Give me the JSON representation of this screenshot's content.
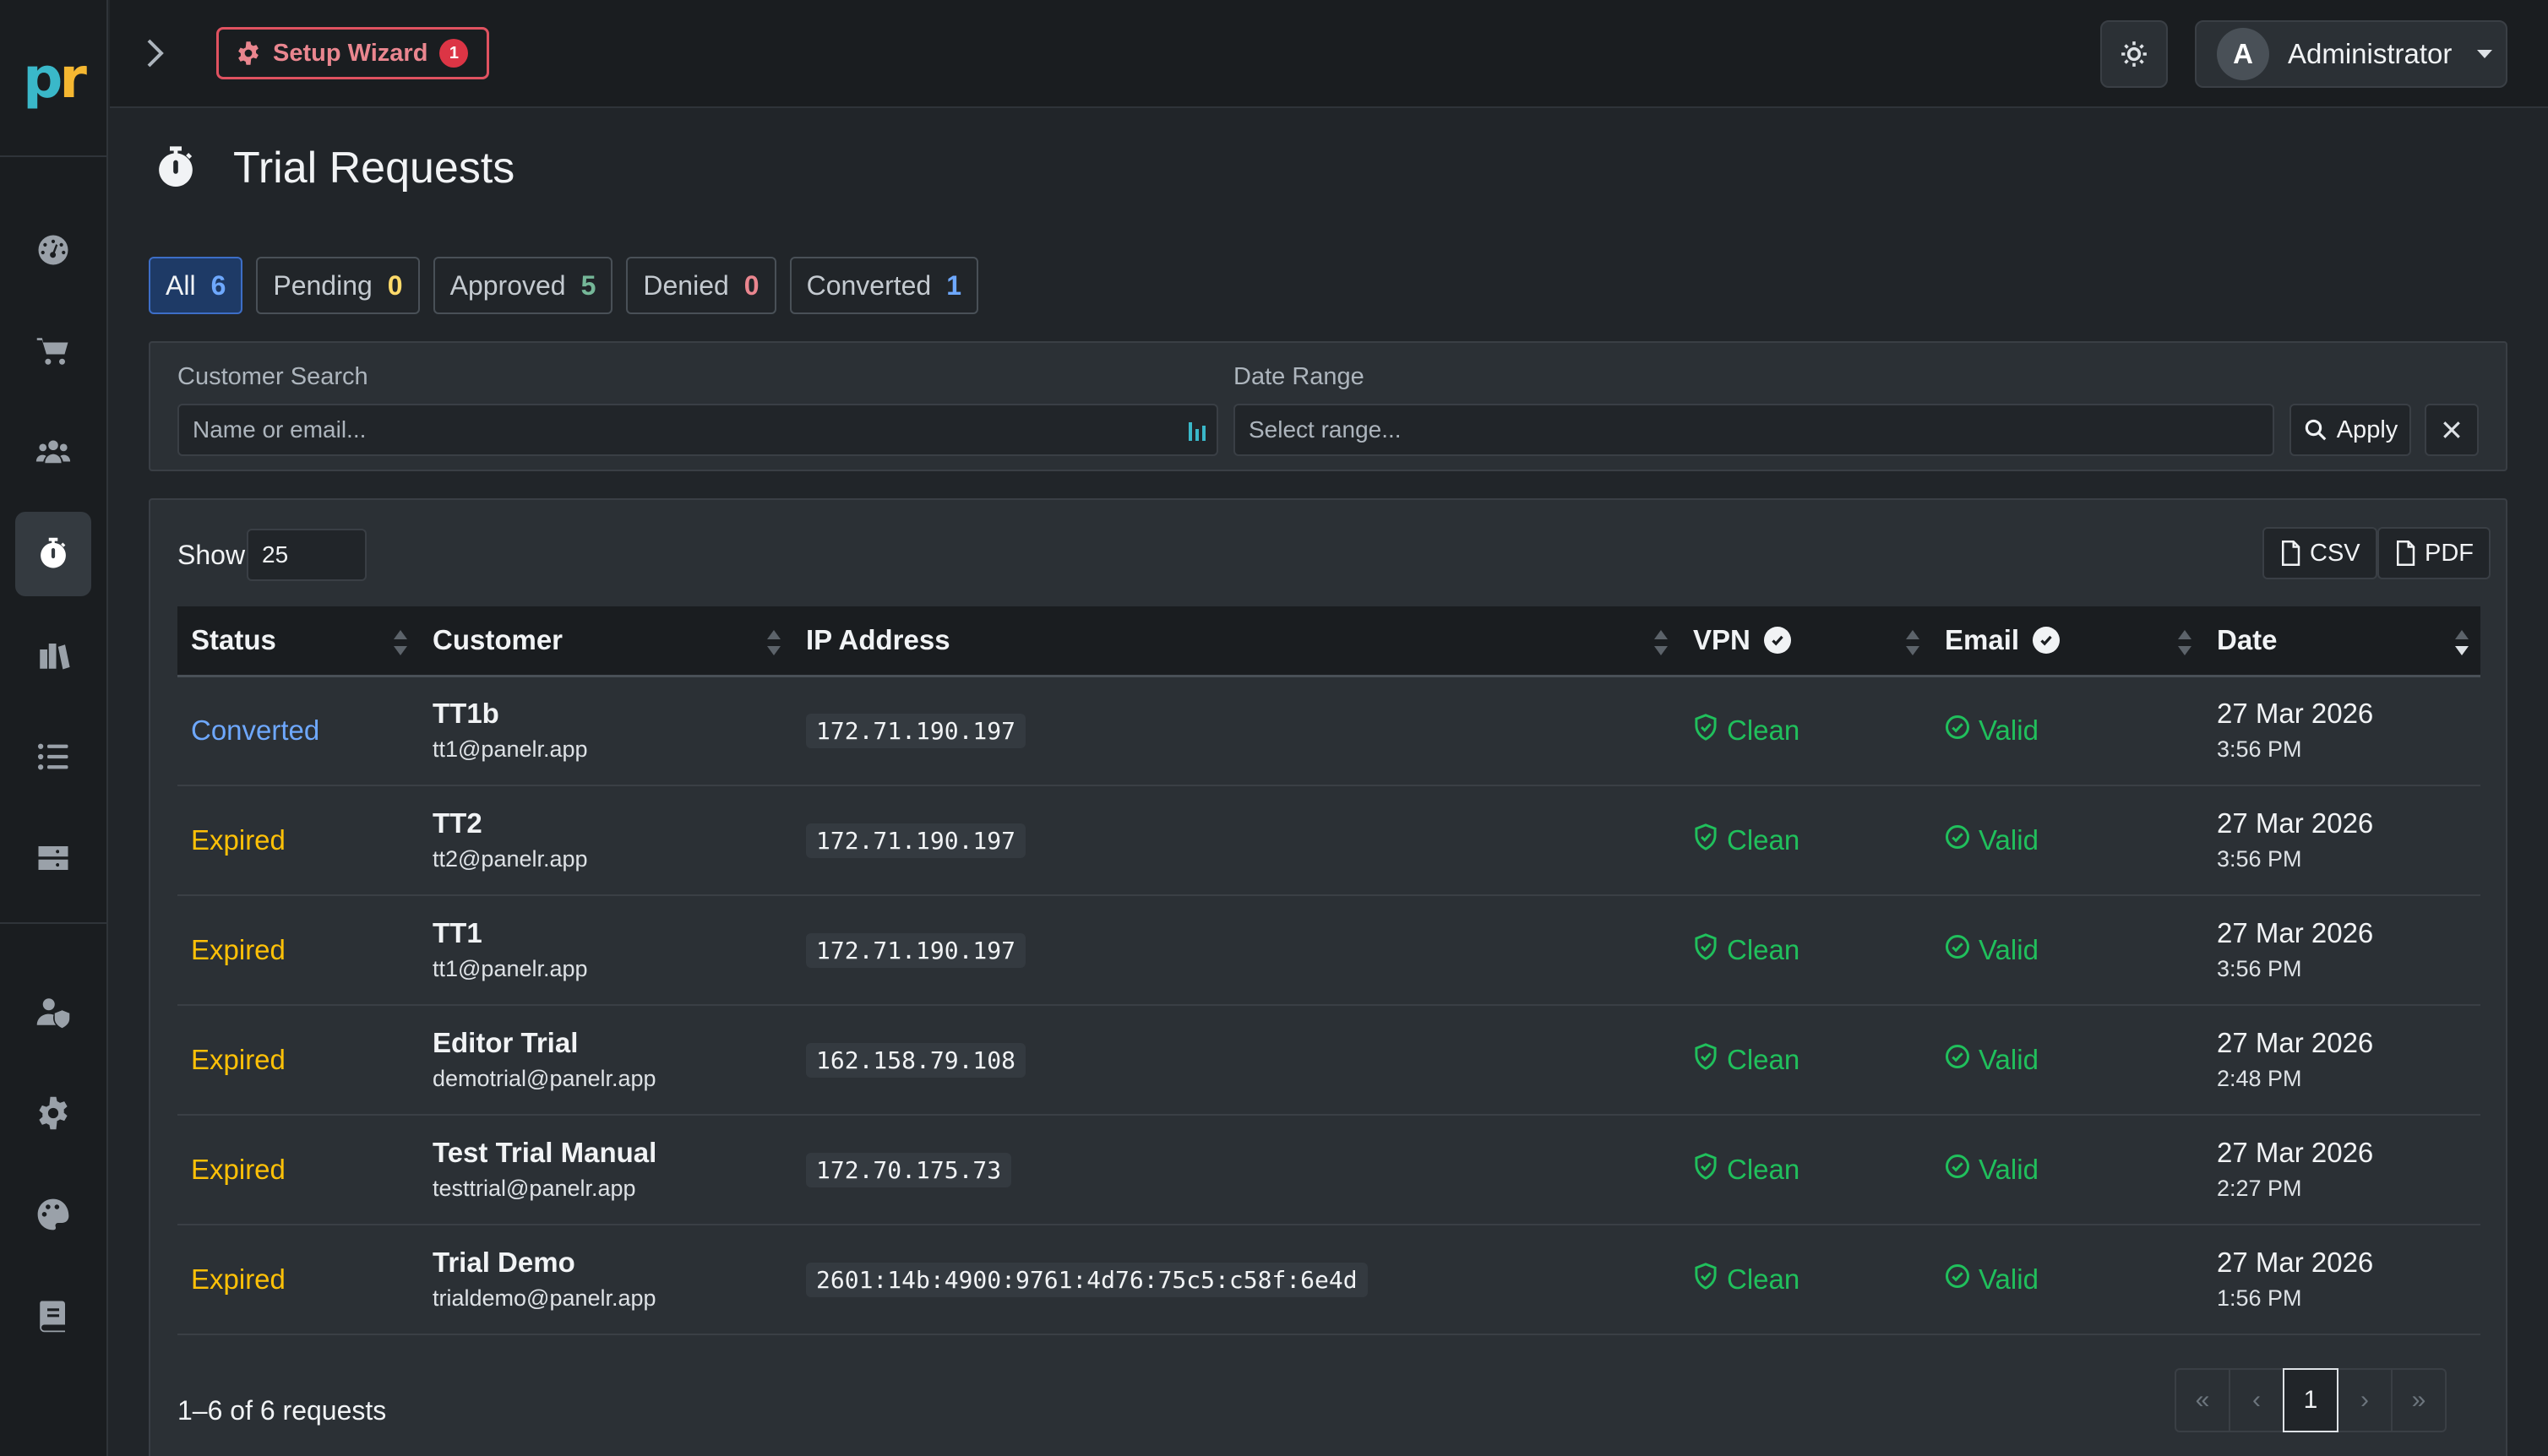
{
  "app": {
    "logo": {
      "p": "p",
      "r": "r"
    }
  },
  "sidebar": {
    "items": [
      {
        "icon": "dashboard-icon",
        "active": false
      },
      {
        "icon": "cart-icon",
        "active": false
      },
      {
        "icon": "users-icon",
        "active": false
      },
      {
        "icon": "stopwatch-icon",
        "active": true
      },
      {
        "icon": "books-icon",
        "active": false
      },
      {
        "icon": "list-icon",
        "active": false
      },
      {
        "icon": "server-icon",
        "active": false
      },
      {
        "icon": "user-shield-icon",
        "active": false
      },
      {
        "icon": "gear-icon",
        "active": false
      },
      {
        "icon": "palette-icon",
        "active": false
      },
      {
        "icon": "book-icon",
        "active": false
      }
    ]
  },
  "topbar": {
    "wizard_label": "Setup Wizard",
    "wizard_badge": "1",
    "user_initial": "A",
    "user_name": "Administrator"
  },
  "page": {
    "title": "Trial Requests"
  },
  "tabs": [
    {
      "label": "All",
      "count": "6",
      "color": "#6ea8fe",
      "active": true
    },
    {
      "label": "Pending",
      "count": "0",
      "color": "#ffda6a",
      "active": false
    },
    {
      "label": "Approved",
      "count": "5",
      "color": "#75b798",
      "active": false
    },
    {
      "label": "Denied",
      "count": "0",
      "color": "#ea868f",
      "active": false
    },
    {
      "label": "Converted",
      "count": "1",
      "color": "#6ea8fe",
      "active": false
    }
  ],
  "filters": {
    "customer_label": "Customer Search",
    "customer_placeholder": "Name or email...",
    "date_label": "Date Range",
    "date_placeholder": "Select range...",
    "apply_label": "Apply"
  },
  "table": {
    "show_label": "Show",
    "page_size": "25",
    "csv_label": "CSV",
    "pdf_label": "PDF",
    "columns": [
      "Status",
      "Customer",
      "IP Address",
      "VPN",
      "Email",
      "Date"
    ],
    "rows": [
      {
        "status": "Converted",
        "name": "TT1b",
        "email": "tt1@panelr.app",
        "ip": "172.71.190.197",
        "vpn": "Clean",
        "email_check": "Valid",
        "date": "27 Mar 2026",
        "time": "3:56 PM"
      },
      {
        "status": "Expired",
        "name": "TT2",
        "email": "tt2@panelr.app",
        "ip": "172.71.190.197",
        "vpn": "Clean",
        "email_check": "Valid",
        "date": "27 Mar 2026",
        "time": "3:56 PM"
      },
      {
        "status": "Expired",
        "name": "TT1",
        "email": "tt1@panelr.app",
        "ip": "172.71.190.197",
        "vpn": "Clean",
        "email_check": "Valid",
        "date": "27 Mar 2026",
        "time": "3:56 PM"
      },
      {
        "status": "Expired",
        "name": "Editor Trial",
        "email": "demotrial@panelr.app",
        "ip": "162.158.79.108",
        "vpn": "Clean",
        "email_check": "Valid",
        "date": "27 Mar 2026",
        "time": "2:48 PM"
      },
      {
        "status": "Expired",
        "name": "Test Trial Manual",
        "email": "testtrial@panelr.app",
        "ip": "172.70.175.73",
        "vpn": "Clean",
        "email_check": "Valid",
        "date": "27 Mar 2026",
        "time": "2:27 PM"
      },
      {
        "status": "Expired",
        "name": "Trial Demo",
        "email": "trialdemo@panelr.app",
        "ip": "2601:14b:4900:9761:4d76:75c5:c58f:6e4d",
        "vpn": "Clean",
        "email_check": "Valid",
        "date": "27 Mar 2026",
        "time": "1:56 PM"
      }
    ],
    "summary": "1–6 of 6 requests",
    "pagination": {
      "first": "«",
      "prev": "‹",
      "current": "1",
      "next": "›",
      "last": "»"
    }
  },
  "colors": {
    "converted": "#6ea8fe",
    "expired": "#ffc107",
    "ok": "#20c05c",
    "danger": "#dc3545"
  }
}
